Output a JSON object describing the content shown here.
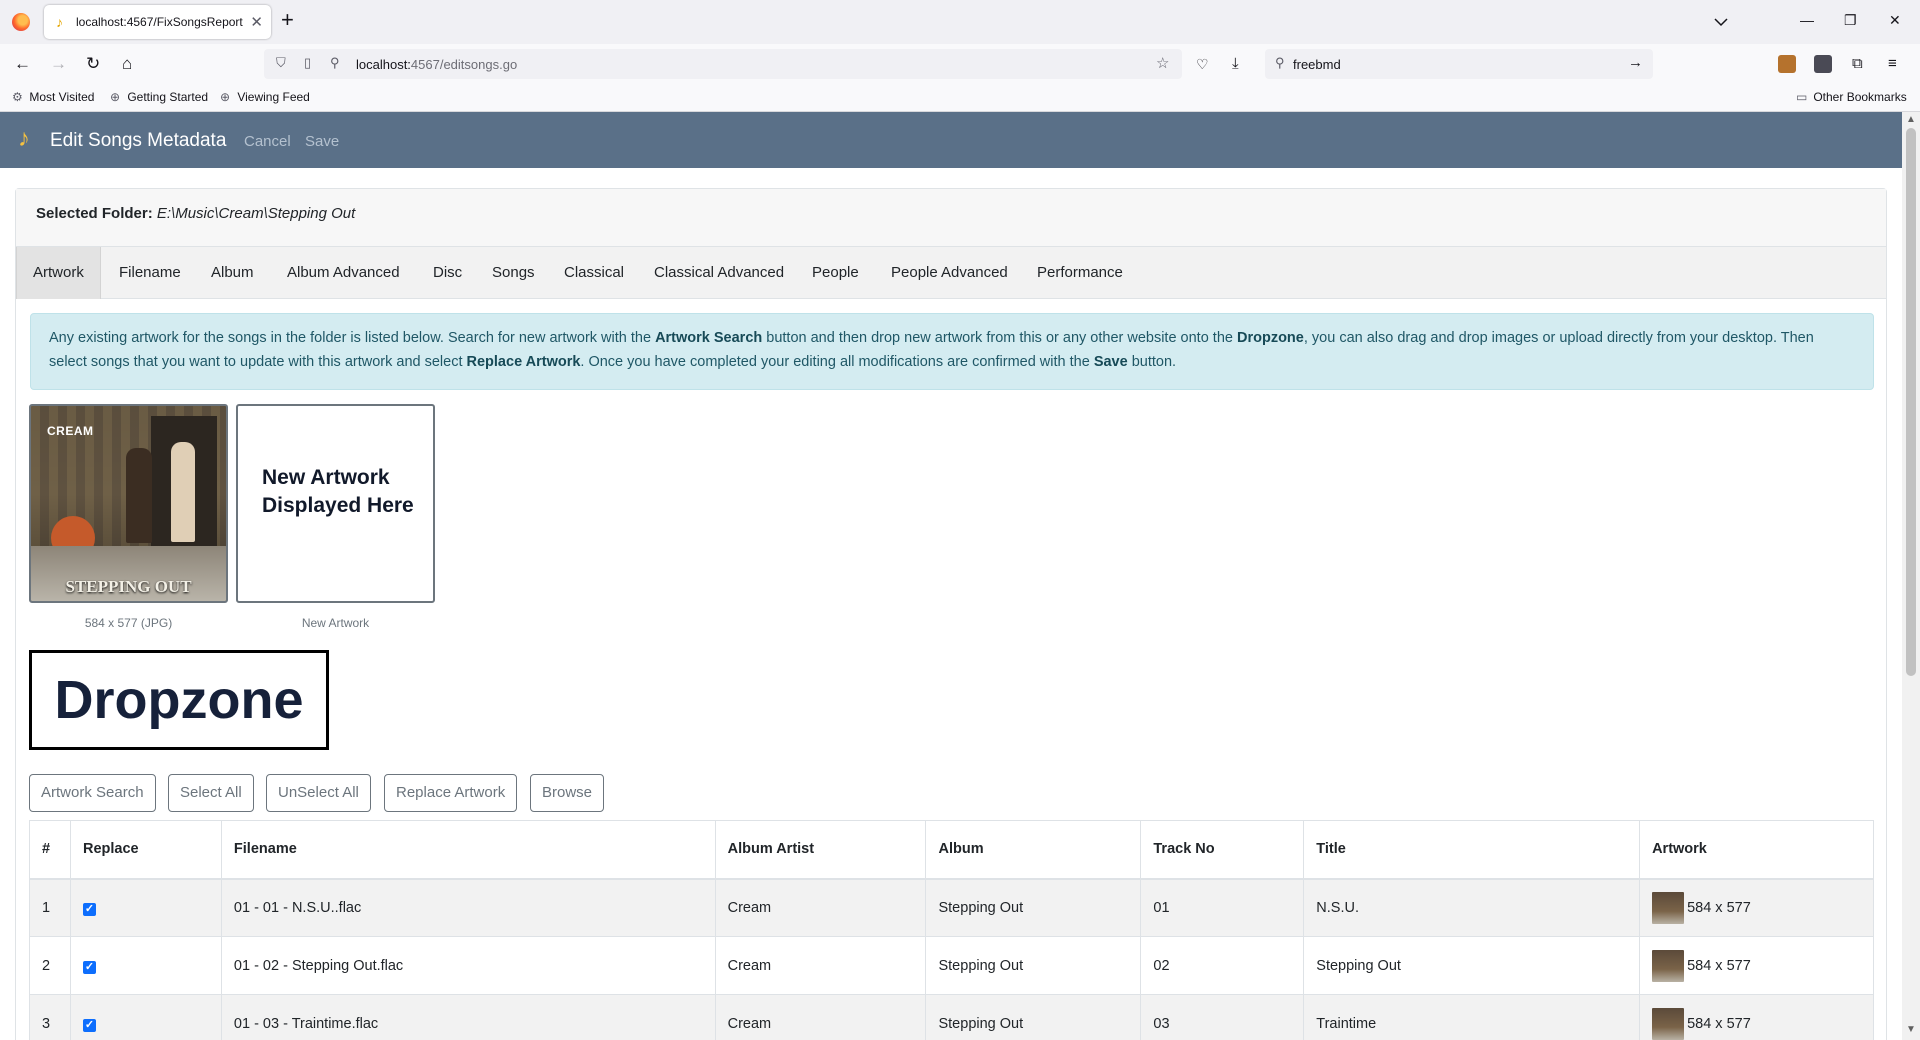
{
  "browser": {
    "tab_title": "localhost:4567/FixSongsReport",
    "url_host": "localhost:",
    "url_rest": "4567/editsongs.go",
    "search_query": "freebmd",
    "bookmarks": [
      "Most Visited",
      "Getting Started",
      "Viewing Feed"
    ],
    "other_bookmarks": "Other Bookmarks"
  },
  "app": {
    "title": "Edit Songs Metadata",
    "cancel_label": "Cancel",
    "save_label": "Save",
    "accent_color": "#5a7088"
  },
  "folder": {
    "label": "Selected Folder:",
    "path": "E:\\Music\\Cream\\Stepping Out"
  },
  "tabs": [
    "Artwork",
    "Filename",
    "Album",
    "Album Advanced",
    "Disc",
    "Songs",
    "Classical",
    "Classical Advanced",
    "People",
    "People Advanced",
    "Performance"
  ],
  "active_tab": "Artwork",
  "info": {
    "p1": "Any existing artwork for the songs in the folder is listed below. Search for new artwork with the ",
    "b1": "Artwork Search",
    "p2": " button and then drop new artwork from this or any other website onto the ",
    "b2": "Dropzone",
    "p3": ", you can also drag and drop images or upload directly from your desktop. Then select songs that you want to update with this artwork and select ",
    "b3": "Replace Artwork",
    "p4": ". Once you have completed your editing all modifications are confirmed with the ",
    "b4": "Save",
    "p5": " button."
  },
  "artwork": {
    "cover_top_text": "CREAM",
    "cover_bottom_text": "STEPPING OUT",
    "existing_caption": "584 x 577 (JPG)",
    "new_placeholder_line1": "New Artwork",
    "new_placeholder_line2": "Displayed Here",
    "new_caption": "New Artwork"
  },
  "dropzone_label": "Dropzone",
  "buttons": {
    "artwork_search": "Artwork Search",
    "select_all": "Select All",
    "unselect_all": "UnSelect All",
    "replace_artwork": "Replace Artwork",
    "browse": "Browse"
  },
  "table": {
    "headers": [
      "#",
      "Replace",
      "Filename",
      "Album Artist",
      "Album",
      "Track No",
      "Title",
      "Artwork"
    ],
    "rows": [
      {
        "num": "1",
        "filename": "01 - 01 - N.S.U..flac",
        "album_artist": "Cream",
        "album": "Stepping Out",
        "track": "01",
        "title": "N.S.U.",
        "artwork": "584 x 577",
        "replace": true
      },
      {
        "num": "2",
        "filename": "01 - 02 - Stepping Out.flac",
        "album_artist": "Cream",
        "album": "Stepping Out",
        "track": "02",
        "title": "Stepping Out",
        "artwork": "584 x 577",
        "replace": true
      },
      {
        "num": "3",
        "filename": "01 - 03 - Traintime.flac",
        "album_artist": "Cream",
        "album": "Stepping Out",
        "track": "03",
        "title": "Traintime",
        "artwork": "584 x 577",
        "replace": true
      }
    ]
  }
}
